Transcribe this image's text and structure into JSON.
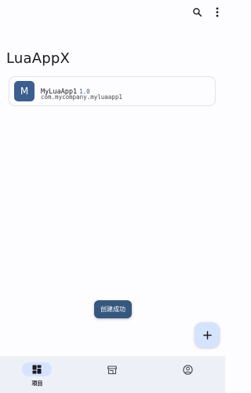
{
  "app_bar": {
    "search_icon": "search-icon",
    "more_icon": "more-vert-icon"
  },
  "page": {
    "title": "LuaAppX"
  },
  "projects": [
    {
      "avatar_letter": "M",
      "name": "MyLuaApp1",
      "version": "1.0",
      "package": "com.mycompany.myluaapp1"
    }
  ],
  "toast": {
    "message": "创建成功"
  },
  "fab": {
    "icon": "plus-icon"
  },
  "bottom_nav": {
    "items": [
      {
        "label": "项目",
        "icon": "dashboard-icon",
        "selected": true
      },
      {
        "label": "",
        "icon": "store-icon",
        "selected": false
      },
      {
        "label": "",
        "icon": "account-circle-icon",
        "selected": false
      }
    ]
  },
  "colors": {
    "background": "#fdfcff",
    "primary": "#3c5f8f",
    "primary_container": "#d5e3ff",
    "nav_background": "#eef0f8",
    "toast_background": "#36587f"
  }
}
